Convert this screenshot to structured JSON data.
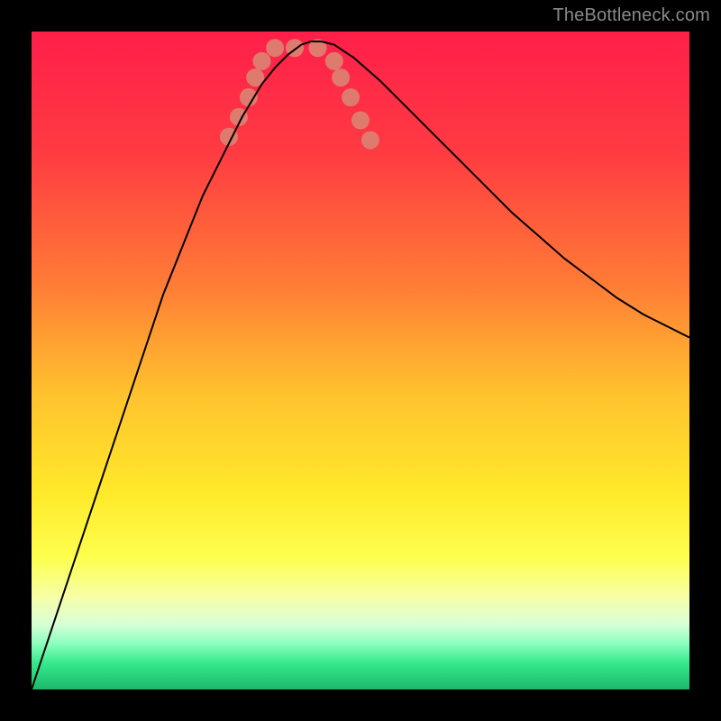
{
  "watermark": "TheBottleneck.com",
  "chart_data": {
    "type": "line",
    "title": "",
    "xlabel": "",
    "ylabel": "",
    "xlim": [
      0,
      100
    ],
    "ylim": [
      0,
      100
    ],
    "grid": false,
    "legend": false,
    "annotations": [],
    "background_gradient_stops": [
      {
        "offset": 0.0,
        "color": "#ff1f4a"
      },
      {
        "offset": 0.18,
        "color": "#ff3a42"
      },
      {
        "offset": 0.38,
        "color": "#ff7a36"
      },
      {
        "offset": 0.55,
        "color": "#ffc22e"
      },
      {
        "offset": 0.7,
        "color": "#ffe92a"
      },
      {
        "offset": 0.8,
        "color": "#fdff4e"
      },
      {
        "offset": 0.86,
        "color": "#f6ffa8"
      },
      {
        "offset": 0.9,
        "color": "#d9ffd6"
      },
      {
        "offset": 0.93,
        "color": "#8cffbf"
      },
      {
        "offset": 0.96,
        "color": "#35e98c"
      },
      {
        "offset": 1.0,
        "color": "#1db86a"
      }
    ],
    "series": [
      {
        "name": "bottleneck-curve",
        "color": "#000000",
        "stroke_width": 2,
        "x": [
          0,
          2,
          4,
          6,
          8,
          10,
          12,
          14,
          16,
          18,
          20,
          22,
          24,
          26,
          28,
          30,
          32,
          33.5,
          35,
          37,
          39,
          41,
          42.5,
          44,
          46,
          49,
          53,
          57,
          61,
          65,
          69,
          73,
          77,
          81,
          85,
          89,
          93,
          97,
          100
        ],
        "y": [
          0,
          6,
          12,
          18,
          24,
          30,
          36,
          42,
          48,
          54,
          60,
          65,
          70,
          75,
          79,
          83,
          87,
          89.5,
          92,
          94.5,
          96.5,
          98,
          98.5,
          98.5,
          98,
          96,
          92.5,
          88.5,
          84.5,
          80.5,
          76.5,
          72.5,
          69,
          65.5,
          62.5,
          59.5,
          57,
          55,
          53.5
        ]
      }
    ],
    "markers": {
      "name": "sweet-spot-markers",
      "color": "#df7a6e",
      "radius": 10,
      "points": [
        {
          "x": 30.0,
          "y": 84.0
        },
        {
          "x": 31.5,
          "y": 87.0
        },
        {
          "x": 33.0,
          "y": 90.0
        },
        {
          "x": 34.0,
          "y": 93.0
        },
        {
          "x": 35.0,
          "y": 95.5
        },
        {
          "x": 37.0,
          "y": 97.5
        },
        {
          "x": 40.0,
          "y": 97.5
        },
        {
          "x": 43.5,
          "y": 97.5
        },
        {
          "x": 46.0,
          "y": 95.5
        },
        {
          "x": 47.0,
          "y": 93.0
        },
        {
          "x": 48.5,
          "y": 90.0
        },
        {
          "x": 50.0,
          "y": 86.5
        },
        {
          "x": 51.5,
          "y": 83.5
        }
      ]
    }
  }
}
